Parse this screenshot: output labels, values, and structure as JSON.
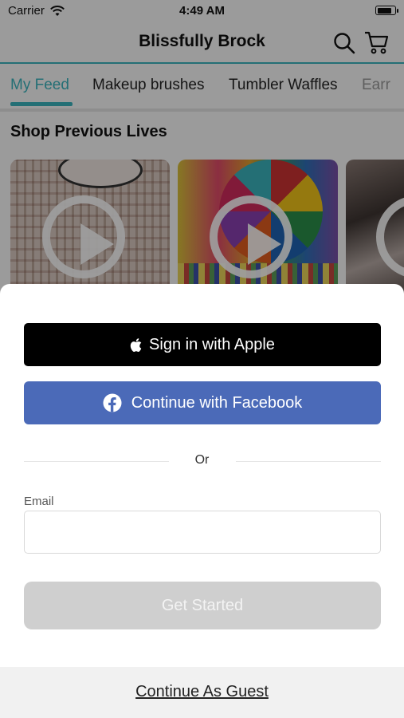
{
  "status_bar": {
    "carrier": "Carrier",
    "time": "4:49 AM",
    "battery_level": 0.9,
    "icons": [
      "wifi-icon",
      "battery-icon"
    ]
  },
  "header": {
    "title": "Blissfully Brock",
    "icons": [
      "search-icon",
      "cart-icon"
    ],
    "accent_color": "#3ab3bd"
  },
  "tabs": [
    {
      "label": "My Feed",
      "active": true
    },
    {
      "label": "Makeup brushes",
      "active": false
    },
    {
      "label": "Tumbler Waffles",
      "active": false
    },
    {
      "label": "Earr",
      "active": false
    }
  ],
  "section": {
    "title": "Shop Previous Lives",
    "cards": [
      {
        "image": "brock-earring-wall-thumbnail",
        "icon": "play-icon"
      },
      {
        "image": "prize-wheel-thumbnail",
        "icon": "play-icon"
      },
      {
        "image": "fabric-stack-thumbnail",
        "icon": "play-icon"
      }
    ]
  },
  "sign_in_sheet": {
    "apple_button": "Sign in with Apple",
    "facebook_button": "Continue with Facebook",
    "divider_text": "Or",
    "email_label": "Email",
    "email_value": "",
    "email_placeholder": "",
    "get_started_button": "Get Started",
    "guest_link": "Continue As Guest",
    "colors": {
      "apple_bg": "#000000",
      "facebook_bg": "#4b6ab8",
      "disabled_button_bg": "#cfcfcf"
    }
  }
}
